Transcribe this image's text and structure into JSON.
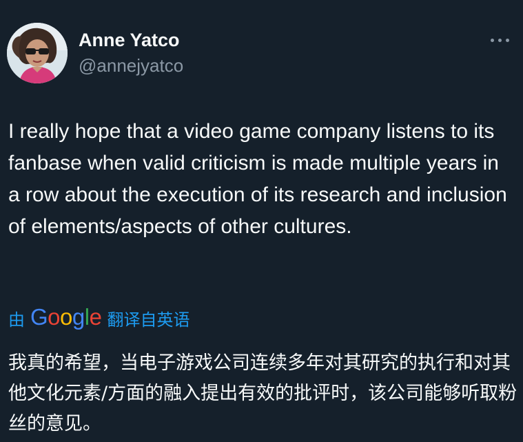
{
  "author": {
    "display_name": "Anne Yatco",
    "handle": "@annejyatco"
  },
  "tweet": {
    "text": "I really hope that a video game company listens to its fanbase when valid criticism is made multiple years in a row about the execution of its research and inclusion of elements/aspects of other cultures."
  },
  "translation": {
    "by_label": "由",
    "provider": "Google",
    "translated_from_label": "翻译自英语",
    "text": "我真的希望，当电子游戏公司连续多年对其研究的执行和对其他文化元素/方面的融入提出有效的批评时，该公司能够听取粉丝的意见。"
  },
  "icons": {
    "more": "more-horizontal-icon",
    "avatar": "avatar-photo"
  },
  "colors": {
    "background": "#15202b",
    "text_primary": "#f7f9f9",
    "text_secondary": "#8b98a5",
    "link": "#1d9bf0",
    "google_blue": "#4285f4",
    "google_red": "#ea4335",
    "google_yellow": "#fbbc05",
    "google_green": "#34a853"
  }
}
